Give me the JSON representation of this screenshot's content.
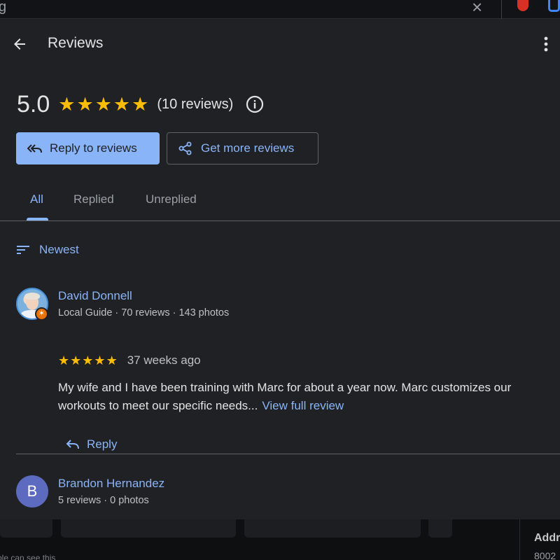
{
  "background": {
    "search_text": "g",
    "caption": "ple can see this",
    "side_label": "Addr",
    "side_value": "8002"
  },
  "header": {
    "title": "Reviews",
    "back_icon": "arrow-back-icon",
    "more_icon": "more-vert-icon"
  },
  "summary": {
    "rating": "5.0",
    "stars": 5,
    "review_count": "(10 reviews)",
    "info_icon": "info-icon"
  },
  "actions": {
    "reply_to_reviews": "Reply to reviews",
    "get_more_reviews": "Get more reviews"
  },
  "tabs": [
    {
      "label": "All",
      "active": true
    },
    {
      "label": "Replied",
      "active": false
    },
    {
      "label": "Unreplied",
      "active": false
    }
  ],
  "sort": {
    "label": "Newest",
    "icon": "sort-icon"
  },
  "reviews": [
    {
      "name": "David Donnell",
      "meta": "Local Guide · 70 reviews · 143 photos",
      "stars": 5,
      "date": "37 weeks ago",
      "text": "My wife and I have been training with Marc for about a year now. Marc customizes our workouts to meet our specific needs...",
      "view_full": "View full review",
      "reply_label": "Reply"
    },
    {
      "name": "Brandon Hernandez",
      "initial": "B",
      "meta": "5 reviews · 0 photos"
    }
  ],
  "colors": {
    "accent": "#8ab4f8",
    "star": "#fbbc04",
    "panel": "#202124",
    "avatar_b": "#5c6bc0",
    "guide_badge": "#e8710a"
  }
}
